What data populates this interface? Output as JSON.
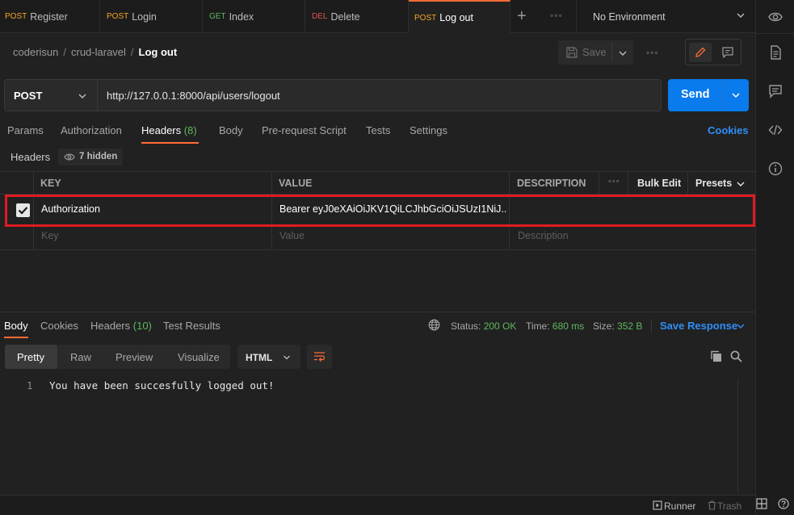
{
  "tabs": [
    {
      "method": "POST",
      "name": "Register"
    },
    {
      "method": "POST",
      "name": "Login"
    },
    {
      "method": "GET",
      "name": "Index"
    },
    {
      "method": "DEL",
      "name": "Delete"
    },
    {
      "method": "POST",
      "name": "Log out"
    }
  ],
  "environment": "No Environment",
  "breadcrumb": {
    "workspace": "coderisun",
    "collection": "crud-laravel",
    "request": "Log out"
  },
  "toolbar": {
    "save_label": "Save"
  },
  "request": {
    "method": "POST",
    "url": "http://127.0.0.1:8000/api/users/logout",
    "send_label": "Send"
  },
  "request_tabs": {
    "params": "Params",
    "authorization": "Authorization",
    "headers": "Headers",
    "headers_count": "(8)",
    "body": "Body",
    "prerequest": "Pre-request Script",
    "tests": "Tests",
    "settings": "Settings",
    "cookies": "Cookies"
  },
  "headers_section": {
    "label": "Headers",
    "hidden": "7 hidden"
  },
  "headers_table": {
    "columns": {
      "key": "KEY",
      "value": "VALUE",
      "description": "DESCRIPTION",
      "bulk_edit": "Bulk Edit",
      "presets": "Presets"
    },
    "rows": [
      {
        "key": "Authorization",
        "value": "Bearer eyJ0eXAiOiJKV1QiLCJhbGciOiJSUzI1NiJ...",
        "description": ""
      }
    ],
    "placeholders": {
      "key": "Key",
      "value": "Value",
      "description": "Description"
    }
  },
  "response_tabs": {
    "body": "Body",
    "cookies": "Cookies",
    "headers": "Headers",
    "headers_count": "(10)",
    "test_results": "Test Results"
  },
  "response_status": {
    "status_label": "Status:",
    "status_value": "200 OK",
    "time_label": "Time:",
    "time_value": "680 ms",
    "size_label": "Size:",
    "size_value": "352 B",
    "save_response": "Save Response"
  },
  "view_tabs": {
    "pretty": "Pretty",
    "raw": "Raw",
    "preview": "Preview",
    "visualize": "Visualize",
    "language": "HTML"
  },
  "response_body": {
    "line_number": "1",
    "text": "You have been succesfully logged out!"
  },
  "statusbar": {
    "runner": "Runner",
    "trash": "Trash"
  },
  "colors": {
    "accent": "#ff6c37",
    "send": "#097bed",
    "link": "#2f8ff7",
    "success": "#5fb85f",
    "highlight": "#e11a22"
  }
}
